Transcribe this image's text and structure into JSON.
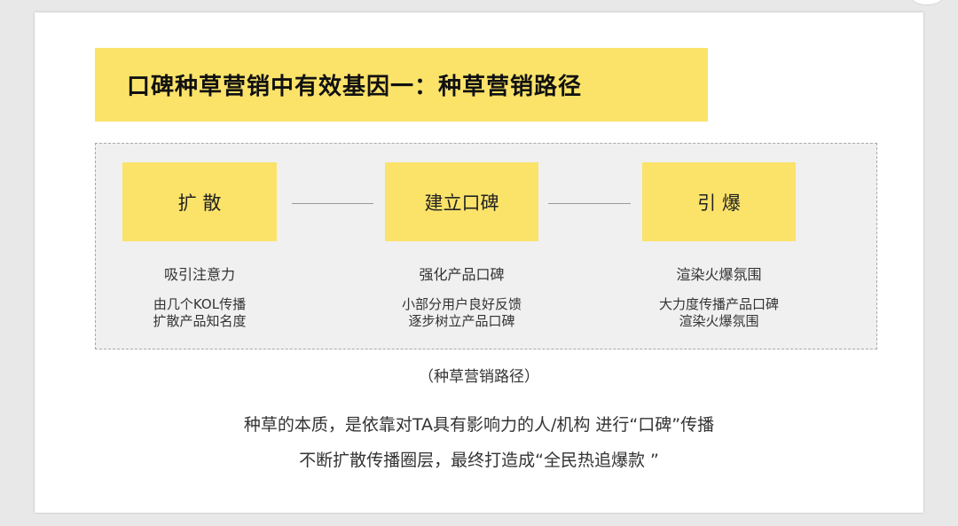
{
  "title": "口碑种草营销中有效基因一：种草营销路径",
  "steps": [
    {
      "label": "扩 散",
      "subtitle": "吸引注意力",
      "desc": [
        "由几个KOL传播",
        "扩散产品知名度"
      ]
    },
    {
      "label": "建立口碑",
      "subtitle": "强化产品口碑",
      "desc": [
        "小部分用户良好反馈",
        "逐步树立产品口碑"
      ]
    },
    {
      "label": "引 爆",
      "subtitle": "渲染火爆氛围",
      "desc": [
        "大力度传播产品口碑",
        "渲染火爆氛围"
      ]
    }
  ],
  "caption": "（种草营销路径）",
  "summary": [
    "种草的本质，是依靠对TA具有影响力的人/机构 进行“口碑”传播",
    "不断扩散传播圈层，最终打造成“全民热追爆款 ”"
  ],
  "colors": {
    "accent_yellow": "#fbe36a",
    "panel_gray": "#f0f0f0",
    "background": "#e8e8e8"
  }
}
